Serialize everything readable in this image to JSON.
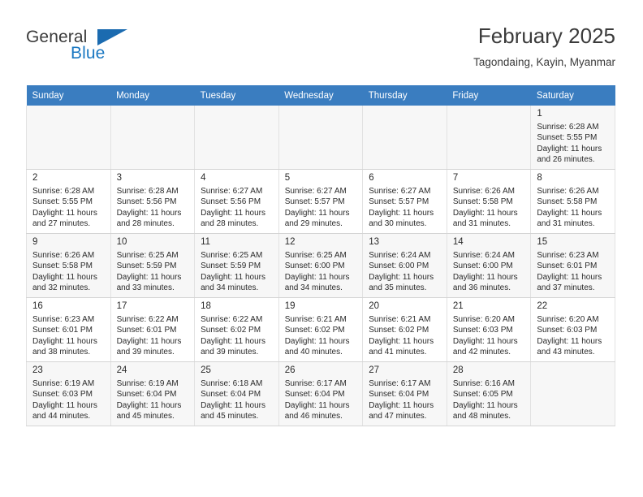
{
  "brand": {
    "name_part1": "General",
    "name_part2": "Blue",
    "flag_icon": "triangle-flag-icon"
  },
  "header": {
    "title": "February 2025",
    "subtitle": "Tagondaing, Kayin, Myanmar"
  },
  "colors": {
    "header_blue": "#3a7dc0",
    "brand_blue": "#1b78c2",
    "row_shade": "#f7f7f7",
    "text": "#2a2a2a"
  },
  "calendar": {
    "weekday_headers": [
      "Sunday",
      "Monday",
      "Tuesday",
      "Wednesday",
      "Thursday",
      "Friday",
      "Saturday"
    ],
    "weeks": [
      [
        {
          "day": "",
          "sunrise": "",
          "sunset": "",
          "daylight_1": "",
          "daylight_2": "",
          "empty": true
        },
        {
          "day": "",
          "sunrise": "",
          "sunset": "",
          "daylight_1": "",
          "daylight_2": "",
          "empty": true
        },
        {
          "day": "",
          "sunrise": "",
          "sunset": "",
          "daylight_1": "",
          "daylight_2": "",
          "empty": true
        },
        {
          "day": "",
          "sunrise": "",
          "sunset": "",
          "daylight_1": "",
          "daylight_2": "",
          "empty": true
        },
        {
          "day": "",
          "sunrise": "",
          "sunset": "",
          "daylight_1": "",
          "daylight_2": "",
          "empty": true
        },
        {
          "day": "",
          "sunrise": "",
          "sunset": "",
          "daylight_1": "",
          "daylight_2": "",
          "empty": true
        },
        {
          "day": "1",
          "sunrise": "Sunrise: 6:28 AM",
          "sunset": "Sunset: 5:55 PM",
          "daylight_1": "Daylight: 11 hours",
          "daylight_2": "and 26 minutes.",
          "empty": false
        }
      ],
      [
        {
          "day": "2",
          "sunrise": "Sunrise: 6:28 AM",
          "sunset": "Sunset: 5:55 PM",
          "daylight_1": "Daylight: 11 hours",
          "daylight_2": "and 27 minutes.",
          "empty": false
        },
        {
          "day": "3",
          "sunrise": "Sunrise: 6:28 AM",
          "sunset": "Sunset: 5:56 PM",
          "daylight_1": "Daylight: 11 hours",
          "daylight_2": "and 28 minutes.",
          "empty": false
        },
        {
          "day": "4",
          "sunrise": "Sunrise: 6:27 AM",
          "sunset": "Sunset: 5:56 PM",
          "daylight_1": "Daylight: 11 hours",
          "daylight_2": "and 28 minutes.",
          "empty": false
        },
        {
          "day": "5",
          "sunrise": "Sunrise: 6:27 AM",
          "sunset": "Sunset: 5:57 PM",
          "daylight_1": "Daylight: 11 hours",
          "daylight_2": "and 29 minutes.",
          "empty": false
        },
        {
          "day": "6",
          "sunrise": "Sunrise: 6:27 AM",
          "sunset": "Sunset: 5:57 PM",
          "daylight_1": "Daylight: 11 hours",
          "daylight_2": "and 30 minutes.",
          "empty": false
        },
        {
          "day": "7",
          "sunrise": "Sunrise: 6:26 AM",
          "sunset": "Sunset: 5:58 PM",
          "daylight_1": "Daylight: 11 hours",
          "daylight_2": "and 31 minutes.",
          "empty": false
        },
        {
          "day": "8",
          "sunrise": "Sunrise: 6:26 AM",
          "sunset": "Sunset: 5:58 PM",
          "daylight_1": "Daylight: 11 hours",
          "daylight_2": "and 31 minutes.",
          "empty": false
        }
      ],
      [
        {
          "day": "9",
          "sunrise": "Sunrise: 6:26 AM",
          "sunset": "Sunset: 5:58 PM",
          "daylight_1": "Daylight: 11 hours",
          "daylight_2": "and 32 minutes.",
          "empty": false
        },
        {
          "day": "10",
          "sunrise": "Sunrise: 6:25 AM",
          "sunset": "Sunset: 5:59 PM",
          "daylight_1": "Daylight: 11 hours",
          "daylight_2": "and 33 minutes.",
          "empty": false
        },
        {
          "day": "11",
          "sunrise": "Sunrise: 6:25 AM",
          "sunset": "Sunset: 5:59 PM",
          "daylight_1": "Daylight: 11 hours",
          "daylight_2": "and 34 minutes.",
          "empty": false
        },
        {
          "day": "12",
          "sunrise": "Sunrise: 6:25 AM",
          "sunset": "Sunset: 6:00 PM",
          "daylight_1": "Daylight: 11 hours",
          "daylight_2": "and 34 minutes.",
          "empty": false
        },
        {
          "day": "13",
          "sunrise": "Sunrise: 6:24 AM",
          "sunset": "Sunset: 6:00 PM",
          "daylight_1": "Daylight: 11 hours",
          "daylight_2": "and 35 minutes.",
          "empty": false
        },
        {
          "day": "14",
          "sunrise": "Sunrise: 6:24 AM",
          "sunset": "Sunset: 6:00 PM",
          "daylight_1": "Daylight: 11 hours",
          "daylight_2": "and 36 minutes.",
          "empty": false
        },
        {
          "day": "15",
          "sunrise": "Sunrise: 6:23 AM",
          "sunset": "Sunset: 6:01 PM",
          "daylight_1": "Daylight: 11 hours",
          "daylight_2": "and 37 minutes.",
          "empty": false
        }
      ],
      [
        {
          "day": "16",
          "sunrise": "Sunrise: 6:23 AM",
          "sunset": "Sunset: 6:01 PM",
          "daylight_1": "Daylight: 11 hours",
          "daylight_2": "and 38 minutes.",
          "empty": false
        },
        {
          "day": "17",
          "sunrise": "Sunrise: 6:22 AM",
          "sunset": "Sunset: 6:01 PM",
          "daylight_1": "Daylight: 11 hours",
          "daylight_2": "and 39 minutes.",
          "empty": false
        },
        {
          "day": "18",
          "sunrise": "Sunrise: 6:22 AM",
          "sunset": "Sunset: 6:02 PM",
          "daylight_1": "Daylight: 11 hours",
          "daylight_2": "and 39 minutes.",
          "empty": false
        },
        {
          "day": "19",
          "sunrise": "Sunrise: 6:21 AM",
          "sunset": "Sunset: 6:02 PM",
          "daylight_1": "Daylight: 11 hours",
          "daylight_2": "and 40 minutes.",
          "empty": false
        },
        {
          "day": "20",
          "sunrise": "Sunrise: 6:21 AM",
          "sunset": "Sunset: 6:02 PM",
          "daylight_1": "Daylight: 11 hours",
          "daylight_2": "and 41 minutes.",
          "empty": false
        },
        {
          "day": "21",
          "sunrise": "Sunrise: 6:20 AM",
          "sunset": "Sunset: 6:03 PM",
          "daylight_1": "Daylight: 11 hours",
          "daylight_2": "and 42 minutes.",
          "empty": false
        },
        {
          "day": "22",
          "sunrise": "Sunrise: 6:20 AM",
          "sunset": "Sunset: 6:03 PM",
          "daylight_1": "Daylight: 11 hours",
          "daylight_2": "and 43 minutes.",
          "empty": false
        }
      ],
      [
        {
          "day": "23",
          "sunrise": "Sunrise: 6:19 AM",
          "sunset": "Sunset: 6:03 PM",
          "daylight_1": "Daylight: 11 hours",
          "daylight_2": "and 44 minutes.",
          "empty": false
        },
        {
          "day": "24",
          "sunrise": "Sunrise: 6:19 AM",
          "sunset": "Sunset: 6:04 PM",
          "daylight_1": "Daylight: 11 hours",
          "daylight_2": "and 45 minutes.",
          "empty": false
        },
        {
          "day": "25",
          "sunrise": "Sunrise: 6:18 AM",
          "sunset": "Sunset: 6:04 PM",
          "daylight_1": "Daylight: 11 hours",
          "daylight_2": "and 45 minutes.",
          "empty": false
        },
        {
          "day": "26",
          "sunrise": "Sunrise: 6:17 AM",
          "sunset": "Sunset: 6:04 PM",
          "daylight_1": "Daylight: 11 hours",
          "daylight_2": "and 46 minutes.",
          "empty": false
        },
        {
          "day": "27",
          "sunrise": "Sunrise: 6:17 AM",
          "sunset": "Sunset: 6:04 PM",
          "daylight_1": "Daylight: 11 hours",
          "daylight_2": "and 47 minutes.",
          "empty": false
        },
        {
          "day": "28",
          "sunrise": "Sunrise: 6:16 AM",
          "sunset": "Sunset: 6:05 PM",
          "daylight_1": "Daylight: 11 hours",
          "daylight_2": "and 48 minutes.",
          "empty": false
        },
        {
          "day": "",
          "sunrise": "",
          "sunset": "",
          "daylight_1": "",
          "daylight_2": "",
          "empty": true
        }
      ]
    ]
  }
}
